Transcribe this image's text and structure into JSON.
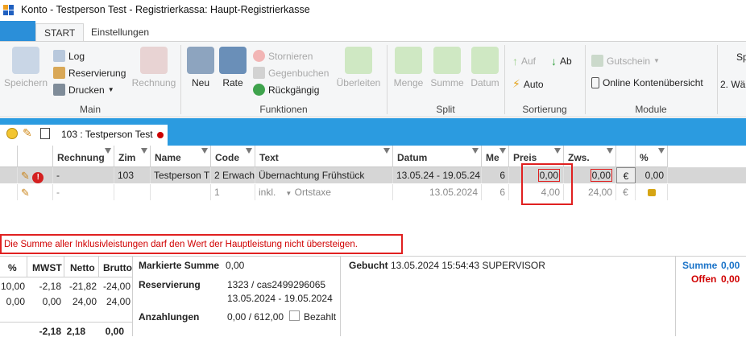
{
  "window": {
    "title": "Konto - Testperson Test - Registrierkassa: Haupt-Registrierkasse"
  },
  "ribbon_tabs": [
    "START",
    "Einstellungen"
  ],
  "ribbon": {
    "main": {
      "speichern": "Speichern",
      "log": "Log",
      "reservierung": "Reservierung",
      "drucken": "Drucken",
      "rechnung": "Rechnung",
      "group": "Main"
    },
    "funktionen": {
      "neu": "Neu",
      "rate": "Rate",
      "stornieren": "Stornieren",
      "gegenbuchen": "Gegenbuchen",
      "rueckgaengig": "Rückgängig",
      "ueberleiten": "Überleiten",
      "group": "Funktionen"
    },
    "split": {
      "menge": "Menge",
      "summe": "Summe",
      "datum": "Datum",
      "group": "Split"
    },
    "sortierung": {
      "auf": "Auf",
      "ab": "Ab",
      "auto": "Auto",
      "group": "Sortierung"
    },
    "modul": {
      "gutschein": "Gutschein",
      "online": "Online Kontenübersicht",
      "group": "Module"
    },
    "extra": {
      "sp": "Sp",
      "waehl": "2. Wäl"
    }
  },
  "customer": {
    "label": "103 :  Testperson Test"
  },
  "grid": {
    "headers": [
      "Rechnung",
      "Zim",
      "Name",
      "Code",
      "Text",
      "Datum",
      "Me",
      "Preis",
      "Zws.",
      "%"
    ],
    "rows": [
      {
        "rechnung": "-",
        "zim": "103",
        "name": "Testperson T",
        "code": "2 Erwach",
        "text": "Übernachtung Frühstück",
        "datum": "13.05.24 - 19.05.24",
        "me": "6",
        "preis": "0,00",
        "zws": "0,00",
        "cur": "€",
        "pct": "0,00"
      },
      {
        "rechnung": "-",
        "zim": "",
        "name": "",
        "code": "1",
        "text_a": "inkl.",
        "text": "Ortstaxe",
        "datum": "13.05.2024",
        "me": "6",
        "preis": "4,00",
        "zws": "24,00",
        "cur": "€",
        "pct": ""
      }
    ]
  },
  "error": "Die Summe aller Inklusivleistungen darf den Wert der Hauptleistung nicht übersteigen.",
  "tax_table": {
    "headers": [
      "%",
      "MWST",
      "Netto",
      "Brutto"
    ],
    "rows": [
      [
        "10,00",
        "-2,18",
        "-21,82",
        "-24,00"
      ],
      [
        "0,00",
        "0,00",
        "24,00",
        "24,00"
      ]
    ],
    "totals": [
      "",
      "-2,18",
      "2,18",
      "0,00"
    ]
  },
  "info": {
    "markierte_label": "Markierte Summe",
    "markierte_value": "0,00",
    "reservierung_label": "Reservierung",
    "reservierung_value": "1323 / cas2499296065",
    "reservierung_dates": "13.05.2024  -  19.05.2024",
    "anzahlungen_label": "Anzahlungen",
    "anzahlungen_value": "0,00 / 612,00",
    "bezahlt": "Bezahlt",
    "gebucht_label": "Gebucht",
    "gebucht_value": "13.05.2024 15:54:43  SUPERVISOR"
  },
  "summary": {
    "summe_label": "Summe",
    "summe_value": "0,00",
    "offen_label": "Offen",
    "offen_value": "0,00"
  },
  "colors": {
    "accent": "#2b9be0",
    "error": "#e02020",
    "summe": "#1a73c8",
    "offen": "#d00000"
  }
}
